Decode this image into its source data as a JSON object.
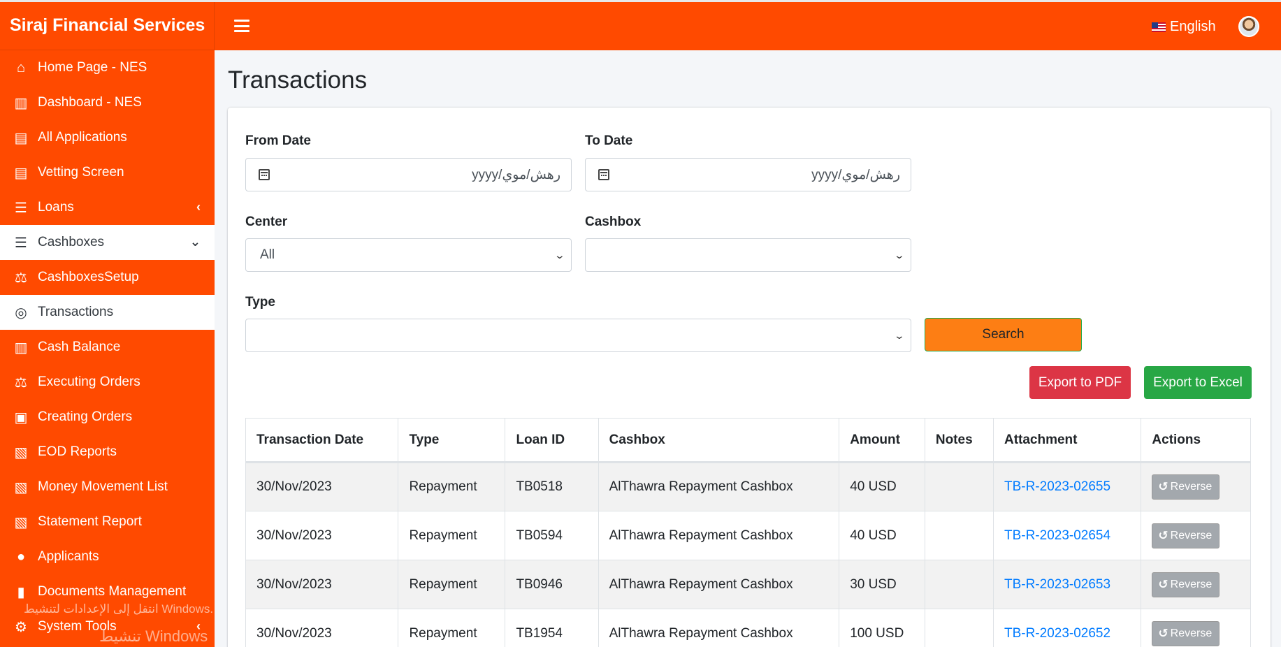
{
  "app": {
    "brand": "Siraj Financial Services",
    "language": "English"
  },
  "sidebar": {
    "items": [
      {
        "label": "Home Page - NES",
        "icon": "home-icon",
        "glyph": "⌂"
      },
      {
        "label": "Dashboard - NES",
        "icon": "bar-chart-icon",
        "glyph": "▥"
      },
      {
        "label": "All Applications",
        "icon": "list-alt-icon",
        "glyph": "▤"
      },
      {
        "label": "Vetting Screen",
        "icon": "list-alt-icon",
        "glyph": "▤"
      },
      {
        "label": "Loans",
        "icon": "list-icon",
        "glyph": "☰",
        "chevron": "‹"
      },
      {
        "label": "Cashboxes",
        "icon": "list-icon",
        "glyph": "☰",
        "chevron": "⌄",
        "state": "expanded"
      },
      {
        "label": "CashboxesSetup",
        "icon": "balance-scale-icon",
        "glyph": "⚖"
      },
      {
        "label": "Transactions",
        "icon": "coins-icon",
        "glyph": "◎",
        "state": "active"
      },
      {
        "label": "Cash Balance",
        "icon": "bar-chart-icon",
        "glyph": "▥"
      },
      {
        "label": "Executing Orders",
        "icon": "balance-scale-icon",
        "glyph": "⚖"
      },
      {
        "label": "Creating Orders",
        "icon": "money-bill-icon",
        "glyph": "▣"
      },
      {
        "label": "EOD Reports",
        "icon": "file-excel-icon",
        "glyph": "▧"
      },
      {
        "label": "Money Movement List",
        "icon": "file-excel-icon",
        "glyph": "▧"
      },
      {
        "label": "Statement Report",
        "icon": "file-excel-icon",
        "glyph": "▧"
      },
      {
        "label": "Applicants",
        "icon": "user-icon",
        "glyph": "●"
      },
      {
        "label": "Documents Management",
        "icon": "file-icon",
        "glyph": "▮"
      },
      {
        "label": "System Tools",
        "icon": "cog-icon",
        "glyph": "⚙",
        "chevron": "‹"
      }
    ],
    "watermark_title": "تنشيط Windows",
    "watermark_sub": "انتقل إلى الإعدادات لتنشيط Windows."
  },
  "page": {
    "title": "Transactions"
  },
  "filters": {
    "from_date_label": "From Date",
    "from_date_placeholder": "yyyy/رهش/موي",
    "to_date_label": "To Date",
    "to_date_placeholder": "yyyy/رهش/موي",
    "center_label": "Center",
    "center_value": "All",
    "cashbox_label": "Cashbox",
    "cashbox_value": "",
    "type_label": "Type",
    "type_value": "",
    "search_button": "Search",
    "export_pdf": "Export to PDF",
    "export_excel": "Export to Excel"
  },
  "table": {
    "headers": [
      "Transaction Date",
      "Type",
      "Loan ID",
      "Cashbox",
      "Amount",
      "Notes",
      "Attachment",
      "Actions"
    ],
    "rows": [
      {
        "date": "30/Nov/2023",
        "type": "Repayment",
        "loan_id": "TB0518",
        "cashbox": "AlThawra Repayment Cashbox",
        "amount": "40 USD",
        "notes": "",
        "attachment": "TB-R-2023-02655",
        "action": "Reverse"
      },
      {
        "date": "30/Nov/2023",
        "type": "Repayment",
        "loan_id": "TB0594",
        "cashbox": "AlThawra Repayment Cashbox",
        "amount": "40 USD",
        "notes": "",
        "attachment": "TB-R-2023-02654",
        "action": "Reverse"
      },
      {
        "date": "30/Nov/2023",
        "type": "Repayment",
        "loan_id": "TB0946",
        "cashbox": "AlThawra Repayment Cashbox",
        "amount": "30 USD",
        "notes": "",
        "attachment": "TB-R-2023-02653",
        "action": "Reverse"
      },
      {
        "date": "30/Nov/2023",
        "type": "Repayment",
        "loan_id": "TB1954",
        "cashbox": "AlThawra Repayment Cashbox",
        "amount": "100 USD",
        "notes": "",
        "attachment": "TB-R-2023-02652",
        "action": "Reverse"
      }
    ]
  },
  "colors": {
    "brand": "#ff4a00",
    "search": "#fd7e14",
    "pdf": "#dc3545",
    "excel": "#28a745",
    "link": "#007bff"
  }
}
